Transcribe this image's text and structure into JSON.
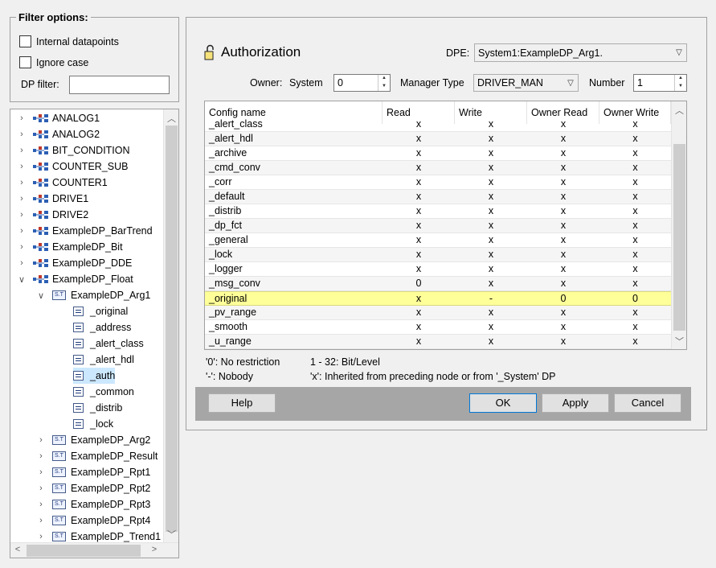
{
  "filter": {
    "title": "Filter options:",
    "internal_label": "Internal datapoints",
    "ignore_case_label": "Ignore case",
    "dp_filter_label": "DP filter:",
    "dp_filter_value": ""
  },
  "tree": {
    "items": [
      {
        "label": "ANALOG1",
        "type": "dp",
        "state": "collapsed"
      },
      {
        "label": "ANALOG2",
        "type": "dp",
        "state": "collapsed"
      },
      {
        "label": "BIT_CONDITION",
        "type": "dp",
        "state": "collapsed"
      },
      {
        "label": "COUNTER_SUB",
        "type": "dp",
        "state": "collapsed"
      },
      {
        "label": "COUNTER1",
        "type": "dp",
        "state": "collapsed"
      },
      {
        "label": "DRIVE1",
        "type": "dp",
        "state": "collapsed"
      },
      {
        "label": "DRIVE2",
        "type": "dp",
        "state": "collapsed"
      },
      {
        "label": "ExampleDP_BarTrend",
        "type": "dp",
        "state": "collapsed"
      },
      {
        "label": "ExampleDP_Bit",
        "type": "dp",
        "state": "collapsed"
      },
      {
        "label": "ExampleDP_DDE",
        "type": "dp",
        "state": "collapsed"
      },
      {
        "label": "ExampleDP_Float",
        "type": "dp",
        "state": "expanded"
      },
      {
        "label": "ExampleDP_Arg1",
        "type": "struct",
        "state": "expanded"
      },
      {
        "label": "_original",
        "type": "config",
        "state": "leaf"
      },
      {
        "label": "_address",
        "type": "config",
        "state": "leaf"
      },
      {
        "label": "_alert_class",
        "type": "config",
        "state": "leaf"
      },
      {
        "label": "_alert_hdl",
        "type": "config",
        "state": "leaf"
      },
      {
        "label": "_auth",
        "type": "config",
        "state": "leaf",
        "selected": true
      },
      {
        "label": "_common",
        "type": "config",
        "state": "leaf"
      },
      {
        "label": "_distrib",
        "type": "config",
        "state": "leaf"
      },
      {
        "label": "_lock",
        "type": "config",
        "state": "leaf"
      },
      {
        "label": "ExampleDP_Arg2",
        "type": "struct",
        "state": "collapsed"
      },
      {
        "label": "ExampleDP_Result",
        "type": "struct",
        "state": "collapsed"
      },
      {
        "label": "ExampleDP_Rpt1",
        "type": "struct",
        "state": "collapsed"
      },
      {
        "label": "ExampleDP_Rpt2",
        "type": "struct",
        "state": "collapsed"
      },
      {
        "label": "ExampleDP_Rpt3",
        "type": "struct",
        "state": "collapsed"
      },
      {
        "label": "ExampleDP_Rpt4",
        "type": "struct",
        "state": "collapsed"
      },
      {
        "label": "ExampleDP_Trend1",
        "type": "struct",
        "state": "collapsed"
      }
    ],
    "struct_icon_text": "S.T"
  },
  "auth": {
    "title": "Authorization",
    "dpe_label": "DPE:",
    "dpe_value": "System1:ExampleDP_Arg1.",
    "owner_label": "Owner:",
    "system_label": "System",
    "system_value": "0",
    "manager_type_label": "Manager Type",
    "manager_type_value": "DRIVER_MAN",
    "number_label": "Number",
    "number_value": "1"
  },
  "table": {
    "headers": [
      "Config name",
      "Read",
      "Write",
      "Owner Read",
      "Owner Write"
    ],
    "rows": [
      [
        "_alert_class",
        "x",
        "x",
        "x",
        "x"
      ],
      [
        "_alert_hdl",
        "x",
        "x",
        "x",
        "x"
      ],
      [
        "_archive",
        "x",
        "x",
        "x",
        "x"
      ],
      [
        "_cmd_conv",
        "x",
        "x",
        "x",
        "x"
      ],
      [
        "_corr",
        "x",
        "x",
        "x",
        "x"
      ],
      [
        "_default",
        "x",
        "x",
        "x",
        "x"
      ],
      [
        "_distrib",
        "x",
        "x",
        "x",
        "x"
      ],
      [
        "_dp_fct",
        "x",
        "x",
        "x",
        "x"
      ],
      [
        "_general",
        "x",
        "x",
        "x",
        "x"
      ],
      [
        "_lock",
        "x",
        "x",
        "x",
        "x"
      ],
      [
        "_logger",
        "x",
        "x",
        "x",
        "x"
      ],
      [
        "_msg_conv",
        "0",
        "x",
        "x",
        "x"
      ],
      [
        "_original",
        "x",
        "-",
        "0",
        "0"
      ],
      [
        "_pv_range",
        "x",
        "x",
        "x",
        "x"
      ],
      [
        "_smooth",
        "x",
        "x",
        "x",
        "x"
      ],
      [
        "_u_range",
        "x",
        "x",
        "x",
        "x"
      ]
    ],
    "highlight_row": 12
  },
  "legend": {
    "l1a": "'0': No restriction",
    "l1b": "1 - 32: Bit/Level",
    "l2a": "'-': Nobody",
    "l2b": "'x': Inherited from preceding node or from '_System' DP"
  },
  "buttons": {
    "help": "Help",
    "ok": "OK",
    "apply": "Apply",
    "cancel": "Cancel"
  },
  "colors": {
    "highlight": "#ffff99",
    "selection": "#cce8ff",
    "button_bar": "#a6a6a6"
  }
}
